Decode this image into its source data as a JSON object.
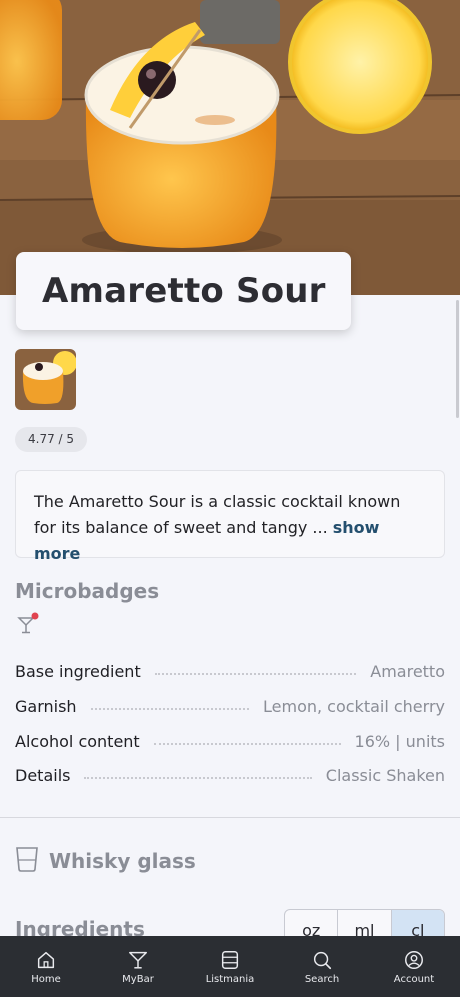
{
  "drink": {
    "name": "Amaretto Sour",
    "rating": "4.77 / 5",
    "description": "The Amaretto Sour is a classic cocktail known for its balance of sweet and tangy ...",
    "show_more": "show more"
  },
  "microbadges": {
    "heading": "Microbadges",
    "icon": "cocktail-glass-icon"
  },
  "attributes": [
    {
      "label": "Base ingredient",
      "value": "Amaretto"
    },
    {
      "label": "Garnish",
      "value": "Lemon, cocktail cherry"
    },
    {
      "label": "Alcohol content",
      "value": "16% | units"
    },
    {
      "label": "Details",
      "value": "Classic  Shaken"
    }
  ],
  "glass": {
    "label": "Whisky glass",
    "icon": "whisky-glass-icon"
  },
  "ingredients": {
    "heading": "Ingredients",
    "units": [
      "oz",
      "ml",
      "cl"
    ],
    "selected_unit": "cl"
  },
  "tabbar": [
    {
      "label": "Home",
      "icon": "home-icon"
    },
    {
      "label": "MyBar",
      "icon": "cocktail-icon"
    },
    {
      "label": "Listmania",
      "icon": "list-icon"
    },
    {
      "label": "Search",
      "icon": "search-icon"
    },
    {
      "label": "Account",
      "icon": "account-icon"
    }
  ],
  "colors": {
    "tabbar_bg": "#2b2e33",
    "link": "#244f6e",
    "selected_unit_bg": "#d3e3f4"
  }
}
